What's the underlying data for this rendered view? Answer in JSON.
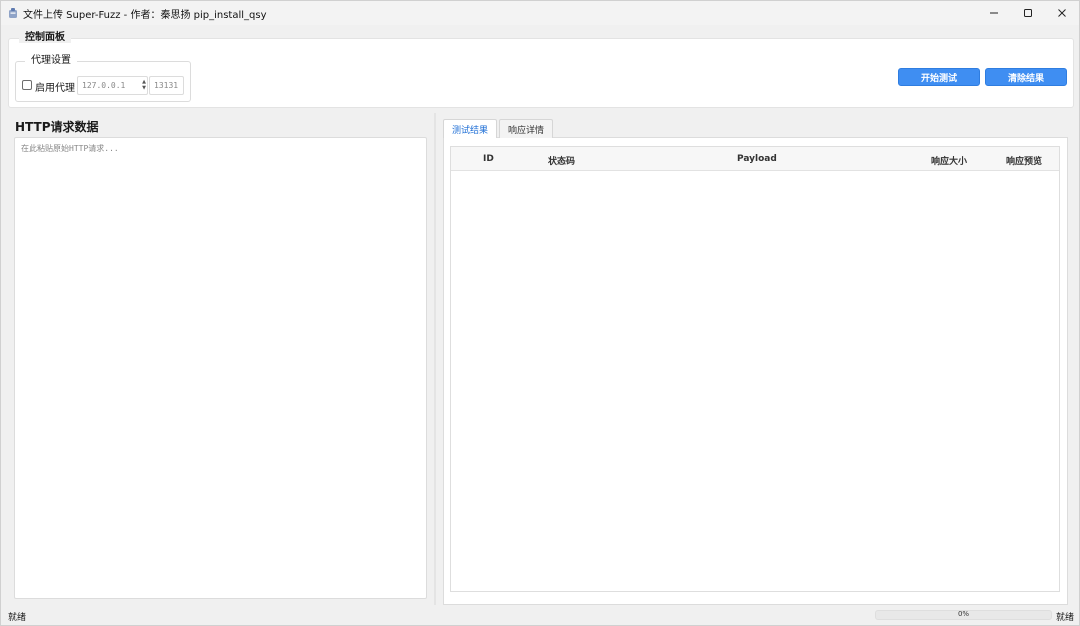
{
  "window": {
    "title": "文件上传 Super-Fuzz  -  作者：秦思扬 pip_install_qsy",
    "icon": "app-icon"
  },
  "control_panel": {
    "label": "控制面板",
    "proxy": {
      "group_label": "代理设置",
      "enable_label": "启用代理",
      "enabled": false,
      "host_value": "127.0.0.1",
      "port_value": "13131"
    },
    "start_button": "开始测试",
    "clear_button": "清除结果"
  },
  "request": {
    "title": "HTTP请求数据",
    "placeholder": "在此粘贴原始HTTP请求..."
  },
  "tabs": [
    {
      "label": "测试结果",
      "active": true
    },
    {
      "label": "响应详情",
      "active": false
    }
  ],
  "results_table": {
    "columns": [
      "ID",
      "状态码",
      "Payload",
      "响应大小",
      "响应预览"
    ],
    "rows": []
  },
  "status_bar": {
    "left_text": "就绪",
    "progress": 0,
    "progress_label": "0%",
    "right_text": "就绪"
  },
  "colors": {
    "accent": "#3f8ef2",
    "tab_active_text": "#1f6fd6",
    "background": "#f0f0f0"
  }
}
